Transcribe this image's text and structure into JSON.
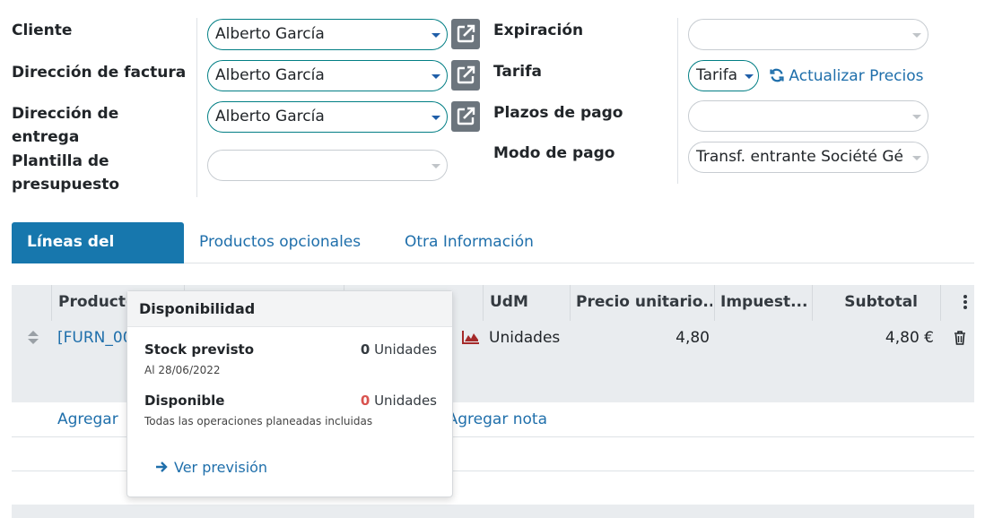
{
  "form": {
    "left": {
      "cliente_label": "Cliente",
      "cliente_value": "Alberto García",
      "factura_label": "Dirección de factura",
      "factura_value": "Alberto García",
      "entrega_label_1": "Dirección de",
      "entrega_label_2": "entrega",
      "entrega_value": "Alberto García",
      "plantilla_label_1": "Plantilla de",
      "plantilla_label_2": "presupuesto",
      "plantilla_value": ""
    },
    "right": {
      "expiracion_label": "Expiración",
      "expiracion_value": "",
      "tarifa_label": "Tarifa",
      "tarifa_value": "Tarifa",
      "actualizar_precios": "Actualizar Precios",
      "plazos_label": "Plazos de pago",
      "plazos_value": "",
      "modo_label": "Modo de pago",
      "modo_value": "Transf. entrante Société Gé"
    }
  },
  "tabs": [
    {
      "label": "Líneas del pedido",
      "active": true
    },
    {
      "label": "Productos opcionales",
      "active": false
    },
    {
      "label": "Otra Información",
      "active": false
    }
  ],
  "table": {
    "headers": {
      "producto": "Producto",
      "udm": "UdM",
      "precio": "Precio unitario...",
      "impuestos": "Impuest...",
      "subtotal": "Subtotal"
    },
    "row": {
      "producto": "[FURN_00",
      "udm": "Unidades",
      "precio": "4,80",
      "subtotal": "4,80 €"
    },
    "add_product": "Agregar",
    "add_note": "Agregar nota"
  },
  "popup": {
    "title": "Disponibilidad",
    "stock_label": "Stock previsto",
    "stock_date": "Al 28/06/2022",
    "stock_qty": "0",
    "stock_unit": "Unidades",
    "disponible_label": "Disponible",
    "disponible_note": "Todas las operaciones planeadas incluidas",
    "disponible_qty": "0",
    "disponible_unit": "Unidades",
    "ver_prevision": "Ver previsión"
  },
  "colors": {
    "accent": "#1777ad",
    "link": "#1f6fab",
    "teal_border": "#017e84",
    "danger": "#d9534f",
    "chart_icon": "#a52a2a"
  }
}
